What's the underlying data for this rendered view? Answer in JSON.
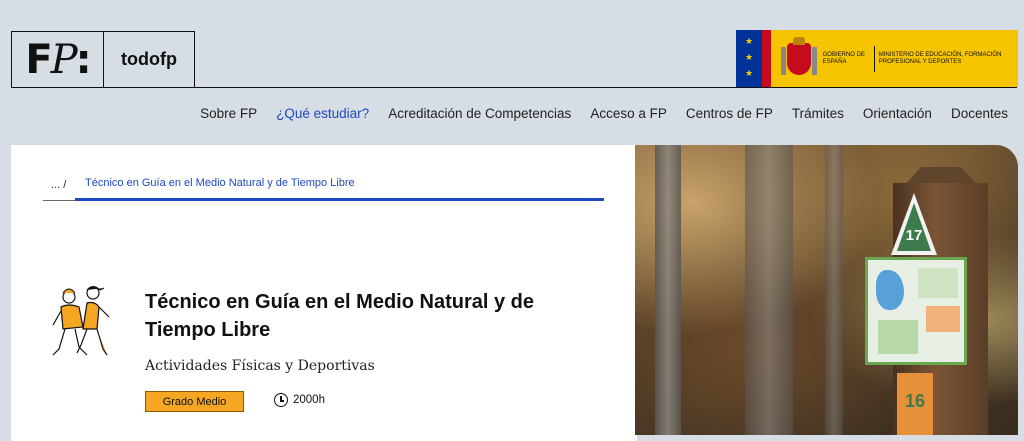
{
  "header": {
    "logo_mark": "FP:",
    "site_name": "todofp",
    "gov_line": "Gobierno de España",
    "ministry_line": "Ministerio de Educación, Formación Profesional y Deportes"
  },
  "nav": {
    "items": [
      {
        "label": "Sobre FP",
        "active": false
      },
      {
        "label": "¿Qué estudiar?",
        "active": true
      },
      {
        "label": "Acreditación de Competencias",
        "active": false
      },
      {
        "label": "Acceso a FP",
        "active": false
      },
      {
        "label": "Centros de FP",
        "active": false
      },
      {
        "label": "Trámites",
        "active": false
      },
      {
        "label": "Orientación",
        "active": false
      },
      {
        "label": "Docentes",
        "active": false
      }
    ]
  },
  "breadcrumb": {
    "root": "... /",
    "current": "Técnico en Guía en el Medio Natural y de Tiempo Libre"
  },
  "course": {
    "title": "Técnico en Guía en el Medio Natural y de Tiempo Libre",
    "family": "Actividades Físicas y Deportivas",
    "level": "Grado Medio",
    "duration": "2000h"
  },
  "photo": {
    "sign_number_top": "17",
    "sign_number_bottom": "16"
  },
  "colors": {
    "accent_blue": "#1d4ac2",
    "badge_orange": "#f5a623",
    "page_bg": "#d6dde4",
    "gov_yellow": "#f6c400"
  }
}
